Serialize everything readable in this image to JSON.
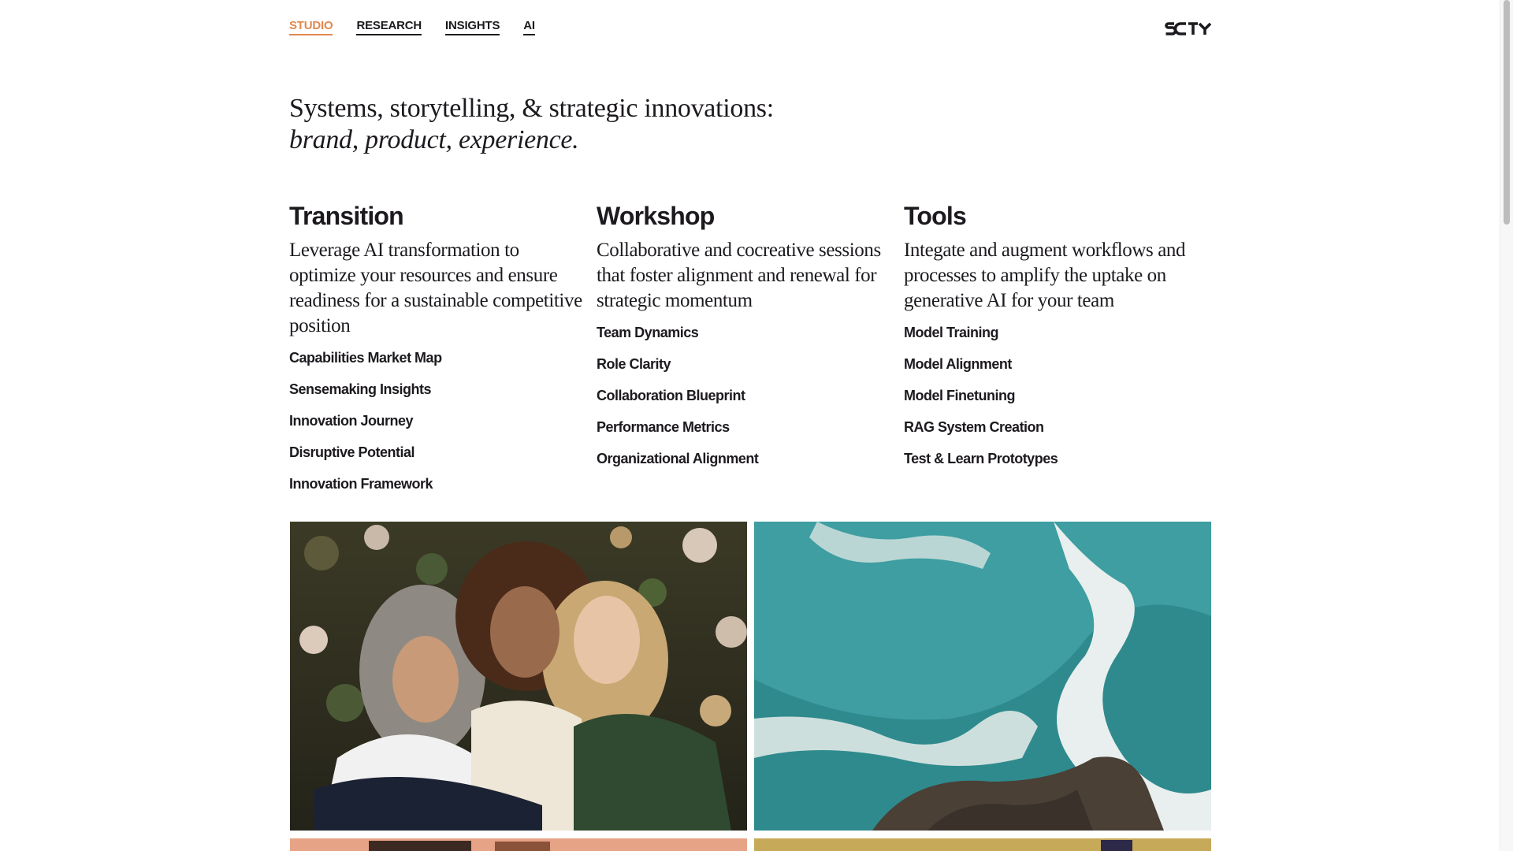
{
  "nav": {
    "items": [
      {
        "label": "STUDIO",
        "active": true
      },
      {
        "label": "RESEARCH",
        "active": false
      },
      {
        "label": "INSIGHTS",
        "active": false
      },
      {
        "label": "AI",
        "active": false
      }
    ],
    "active_color": "#e0884d",
    "logo_text": "SCTY"
  },
  "hero": {
    "line1": "Systems, storytelling, & strategic innovations:",
    "line2": "brand, product, experience."
  },
  "columns": [
    {
      "title": "Transition",
      "description": "Leverage AI transformation to optimize your resources and ensure readiness for a sustainable competitive position",
      "items": [
        "Capabilities Market Map",
        "Sensemaking Insights",
        "Innovation Journey",
        "Disruptive Potential",
        "Innovation Framework"
      ]
    },
    {
      "title": "Workshop",
      "description": "Collaborative and cocreative sessions that foster alignment and renewal for strategic momentum",
      "items": [
        "Team Dynamics",
        "Role Clarity",
        "Collaboration Blueprint",
        "Performance Metrics",
        "Organizational Alignment"
      ]
    },
    {
      "title": "Tools",
      "description": "Integate and augment workflows and processes to amplify the uptake on generative AI for your team",
      "items": [
        "Model Training",
        "Model Alignment",
        "Model Finetuning",
        "RAG System Creation",
        "Test & Learn Prototypes"
      ]
    }
  ],
  "images": [
    {
      "name": "three-women-portrait-photo"
    },
    {
      "name": "aerial-ocean-waves-photo"
    },
    {
      "name": "partial-photo-bottom-left"
    },
    {
      "name": "partial-photo-bottom-right"
    }
  ],
  "colors": {
    "text": "#1d1a1f",
    "accent": "#e0884d",
    "background": "#ffffff"
  }
}
